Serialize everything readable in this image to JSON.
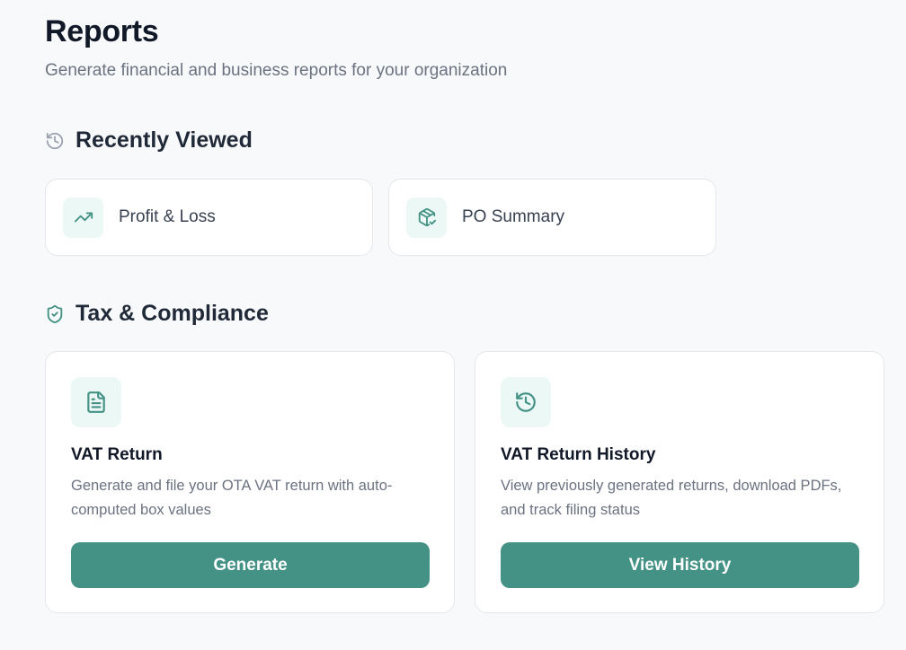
{
  "header": {
    "title": "Reports",
    "subtitle": "Generate financial and business reports for your organization"
  },
  "recently_viewed": {
    "title": "Recently Viewed",
    "icon": "history-icon",
    "items": [
      {
        "label": "Profit & Loss",
        "icon": "trending-up-icon"
      },
      {
        "label": "PO Summary",
        "icon": "package-check-icon"
      }
    ]
  },
  "tax_compliance": {
    "title": "Tax & Compliance",
    "icon": "shield-check-icon",
    "cards": [
      {
        "title": "VAT Return",
        "description": "Generate and file your OTA VAT return with auto-computed box values",
        "button_label": "Generate",
        "icon": "file-text-icon"
      },
      {
        "title": "VAT Return History",
        "description": "View previously generated returns, download PDFs, and track filing status",
        "button_label": "View History",
        "icon": "history-icon"
      }
    ]
  },
  "colors": {
    "accent": "#449285",
    "icon_bg": "#ecf8f5",
    "page_bg": "#f8f9fb"
  }
}
